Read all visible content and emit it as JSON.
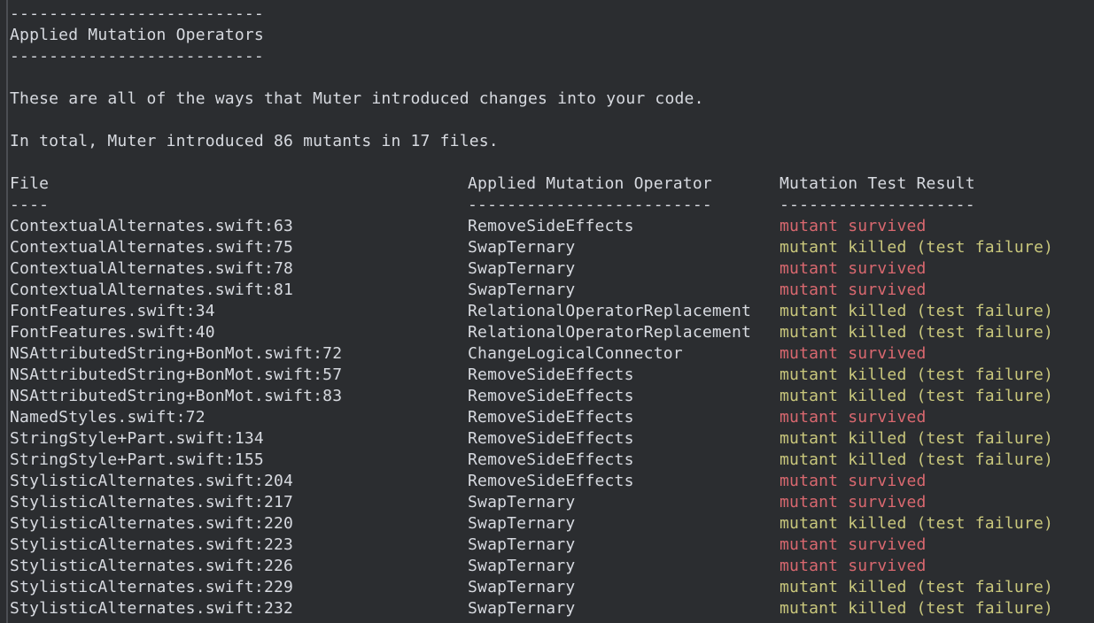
{
  "header": {
    "divider_top": "--------------------------",
    "title": "Applied Mutation Operators",
    "divider_bottom": "--------------------------"
  },
  "intro": {
    "description": "These are all of the ways that Muter introduced changes into your code.",
    "summary": "In total, Muter introduced 86 mutants in 17 files."
  },
  "table": {
    "headers": {
      "file": "File",
      "operator": "Applied Mutation Operator",
      "result": "Mutation Test Result"
    },
    "underlines": {
      "file": "----",
      "operator": "-------------------------",
      "result": "--------------------"
    },
    "rows": [
      {
        "file": "ContextualAlternates.swift:63",
        "operator": "RemoveSideEffects",
        "result": "mutant survived",
        "status": "survived"
      },
      {
        "file": "ContextualAlternates.swift:75",
        "operator": "SwapTernary",
        "result": "mutant killed (test failure)",
        "status": "killed"
      },
      {
        "file": "ContextualAlternates.swift:78",
        "operator": "SwapTernary",
        "result": "mutant survived",
        "status": "survived"
      },
      {
        "file": "ContextualAlternates.swift:81",
        "operator": "SwapTernary",
        "result": "mutant survived",
        "status": "survived"
      },
      {
        "file": "FontFeatures.swift:34",
        "operator": "RelationalOperatorReplacement",
        "result": "mutant killed (test failure)",
        "status": "killed"
      },
      {
        "file": "FontFeatures.swift:40",
        "operator": "RelationalOperatorReplacement",
        "result": "mutant killed (test failure)",
        "status": "killed"
      },
      {
        "file": "NSAttributedString+BonMot.swift:72",
        "operator": "ChangeLogicalConnector",
        "result": "mutant survived",
        "status": "survived"
      },
      {
        "file": "NSAttributedString+BonMot.swift:57",
        "operator": "RemoveSideEffects",
        "result": "mutant killed (test failure)",
        "status": "killed"
      },
      {
        "file": "NSAttributedString+BonMot.swift:83",
        "operator": "RemoveSideEffects",
        "result": "mutant killed (test failure)",
        "status": "killed"
      },
      {
        "file": "NamedStyles.swift:72",
        "operator": "RemoveSideEffects",
        "result": "mutant survived",
        "status": "survived"
      },
      {
        "file": "StringStyle+Part.swift:134",
        "operator": "RemoveSideEffects",
        "result": "mutant killed (test failure)",
        "status": "killed"
      },
      {
        "file": "StringStyle+Part.swift:155",
        "operator": "RemoveSideEffects",
        "result": "mutant killed (test failure)",
        "status": "killed"
      },
      {
        "file": "StylisticAlternates.swift:204",
        "operator": "RemoveSideEffects",
        "result": "mutant survived",
        "status": "survived"
      },
      {
        "file": "StylisticAlternates.swift:217",
        "operator": "SwapTernary",
        "result": "mutant survived",
        "status": "survived"
      },
      {
        "file": "StylisticAlternates.swift:220",
        "operator": "SwapTernary",
        "result": "mutant killed (test failure)",
        "status": "killed"
      },
      {
        "file": "StylisticAlternates.swift:223",
        "operator": "SwapTernary",
        "result": "mutant survived",
        "status": "survived"
      },
      {
        "file": "StylisticAlternates.swift:226",
        "operator": "SwapTernary",
        "result": "mutant survived",
        "status": "survived"
      },
      {
        "file": "StylisticAlternates.swift:229",
        "operator": "SwapTernary",
        "result": "mutant killed (test failure)",
        "status": "killed"
      },
      {
        "file": "StylisticAlternates.swift:232",
        "operator": "SwapTernary",
        "result": "mutant killed (test failure)",
        "status": "killed"
      }
    ]
  },
  "colors": {
    "background": "#2b2d30",
    "text": "#d7dae0",
    "survived": "#d9686f",
    "killed": "#c9c77c"
  }
}
